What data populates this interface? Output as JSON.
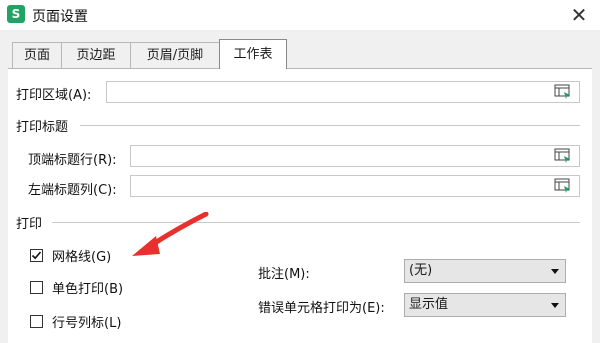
{
  "window": {
    "title": "页面设置",
    "app_icon_letter": "S",
    "close_glyph": "✕"
  },
  "tabs": [
    {
      "label": "页面",
      "active": false
    },
    {
      "label": "页边距",
      "active": false
    },
    {
      "label": "页眉/页脚",
      "active": false
    },
    {
      "label": "工作表",
      "active": true
    }
  ],
  "print_area": {
    "label": "打印区域(A):",
    "value": ""
  },
  "print_titles": {
    "section": "打印标题",
    "top_rows_label": "顶端标题行(R):",
    "top_rows_value": "",
    "left_cols_label": "左端标题列(C):",
    "left_cols_value": ""
  },
  "print": {
    "section": "打印",
    "gridlines": {
      "label": "网格线(G)",
      "checked": true
    },
    "single_color": {
      "label": "单色打印(B)",
      "checked": false
    },
    "row_col_headers": {
      "label": "行号列标(L)",
      "checked": false
    },
    "comments_label": "批注(M):",
    "comments_value": "(无)",
    "errors_label": "错误单元格打印为(E):",
    "errors_value": "显示值"
  },
  "colors": {
    "accent_green": "#21a366",
    "annotation_arrow": "#e8302f"
  }
}
